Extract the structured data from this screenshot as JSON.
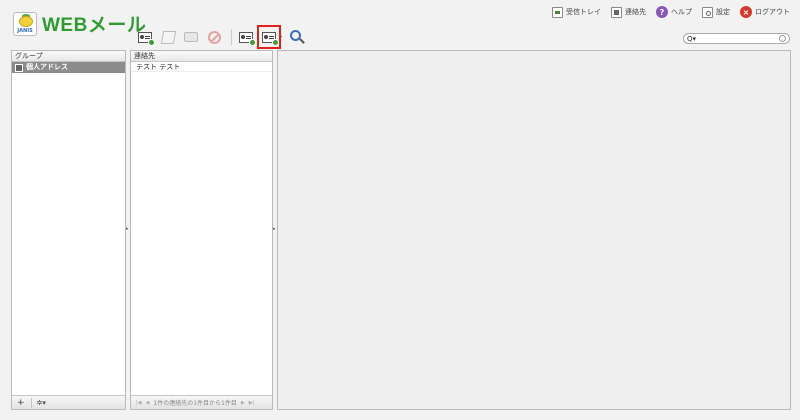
{
  "header": {
    "logo_badge": "JANIS",
    "logo_text": "WEBメール",
    "nav": [
      {
        "label": "受信トレイ",
        "icon": "inbox-tray-icon"
      },
      {
        "label": "連絡先",
        "icon": "address-book-icon"
      },
      {
        "label": "ヘルプ",
        "icon": "help-icon"
      },
      {
        "label": "設定",
        "icon": "settings-icon"
      },
      {
        "label": "ログアウト",
        "icon": "logout-icon"
      }
    ],
    "help_glyph": "?",
    "logout_glyph": "×"
  },
  "toolbar": {
    "buttons": [
      "add-contact",
      "edit-contact",
      "print",
      "delete",
      "import-contacts",
      "export-contacts",
      "search"
    ],
    "highlighted": "export-contacts",
    "caret": "▾"
  },
  "search": {
    "icon": "Q▾",
    "value": "",
    "placeholder": ""
  },
  "groups_panel": {
    "header": "グループ",
    "items": [
      {
        "label": "個人アドレス",
        "selected": true
      }
    ],
    "footer": {
      "add": "+",
      "options": "✲▾"
    }
  },
  "contacts_panel": {
    "header": "連絡先",
    "items": [
      {
        "label": "テスト テスト"
      }
    ],
    "pager": {
      "first": "|◀",
      "prev": "◀",
      "text": "1件の連絡先の1件目から1件目",
      "next": "▶",
      "last": "▶|"
    }
  },
  "colors": {
    "accent_green": "#2f9a2f",
    "highlight_red": "#e0201a",
    "selected_row": "#8c8c8c"
  }
}
